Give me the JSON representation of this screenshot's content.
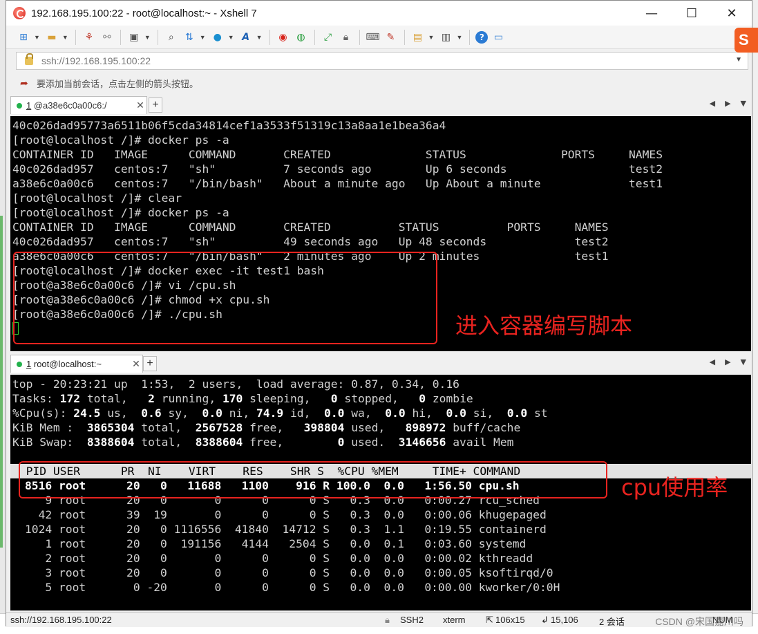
{
  "window": {
    "title": "192.168.195.100:22 - root@localhost:~ - Xshell 7",
    "controls": {
      "minimize": "—",
      "maximize": "☐",
      "close": "✕"
    }
  },
  "toolbar": {
    "icons": [
      "new-session-icon",
      "open-folder-icon",
      "disconnect-icon",
      "reconnect-icon",
      "properties-icon",
      "find-icon",
      "transfer-icon",
      "globe-icon",
      "font-icon",
      "xshell-icon",
      "xftp-icon",
      "fullscreen-icon",
      "lock-icon",
      "keyboard-icon",
      "highlight-icon",
      "script-icon",
      "layout-icon",
      "help-icon",
      "chat-icon"
    ]
  },
  "addressbar": {
    "value": "ssh://192.168.195.100:22"
  },
  "hintbar": {
    "text": "要添加当前会话，点击左侧的箭头按钮。"
  },
  "tabs_top": {
    "num": "1",
    "label": "@a38e6c0a00c6:/"
  },
  "tabs_bottom": {
    "num": "1",
    "label": "root@localhost:~"
  },
  "terminal_top": {
    "lines": [
      "40c026dad95773a6511b06f5cda34814cef1a3533f51319c13a8aa1e1bea36a4",
      "[root@localhost /]# docker ps -a",
      "CONTAINER ID   IMAGE      COMMAND       CREATED              STATUS              PORTS     NAMES",
      "40c026dad957   centos:7   \"sh\"          7 seconds ago        Up 6 seconds                  test2",
      "a38e6c0a00c6   centos:7   \"/bin/bash\"   About a minute ago   Up About a minute             test1",
      "[root@localhost /]# clear",
      "[root@localhost /]# docker ps -a",
      "CONTAINER ID   IMAGE      COMMAND       CREATED          STATUS          PORTS     NAMES",
      "40c026dad957   centos:7   \"sh\"          49 seconds ago   Up 48 seconds             test2",
      "a38e6c0a00c6   centos:7   \"/bin/bash\"   2 minutes ago    Up 2 minutes              test1",
      "[root@localhost /]# docker exec -it test1 bash",
      "[root@a38e6c0a00c6 /]# vi /cpu.sh",
      "[root@a38e6c0a00c6 /]# chmod +x cpu.sh",
      "[root@a38e6c0a00c6 /]# ./cpu.sh"
    ],
    "annotation": "进入容器编写脚本"
  },
  "terminal_bottom": {
    "top_line": "top - 20:23:21 up  1:53,  2 users,  load average: 0.87, 0.34, 0.16",
    "tasks": {
      "label": "Tasks:",
      "total": "172",
      "running": "2",
      "sleeping": "170",
      "stopped": "0",
      "zombie": "0"
    },
    "cpu": {
      "label": "%Cpu(s):",
      "us": "24.5",
      "sy": "0.6",
      "ni": "0.0",
      "id": "74.9",
      "wa": "0.0",
      "hi": "0.0",
      "si": "0.0",
      "st": "0.0"
    },
    "mem": {
      "label": "KiB Mem :",
      "total": "3865304",
      "free": "2567528",
      "used": "398804",
      "buff": "898972"
    },
    "swap": {
      "label": "KiB Swap:",
      "total": "8388604",
      "free": "8388604",
      "used": "0",
      "avail": "3146656"
    },
    "header": "  PID USER      PR  NI    VIRT    RES    SHR S  %CPU %MEM     TIME+ COMMAND",
    "rows": [
      "8516 root      20   0   11688   1100    916 R 100.0  0.0   1:56.50 cpu.sh",
      "   9 root      20   0       0      0      0 S   0.3  0.0   0:00.27 rcu_sched",
      "  42 root      39  19       0      0      0 S   0.3  0.0   0:00.06 khugepaged",
      "1024 root      20   0 1116556  41840  14712 S   0.3  1.1   0:19.55 containerd",
      "   1 root      20   0  191156   4144   2504 S   0.0  0.1   0:03.60 systemd",
      "   2 root      20   0       0      0      0 S   0.0  0.0   0:00.02 kthreadd",
      "   3 root      20   0       0      0      0 S   0.0  0.0   0:00.05 ksoftirqd/0",
      "   5 root       0 -20       0      0      0 S   0.0  0.0   0:00.00 kworker/0:0H"
    ],
    "annotation": "cpu使用率"
  },
  "statusbar": {
    "address": "ssh://192.168.195.100:22",
    "protocol": "SSH2",
    "term": "xterm",
    "size": "106x15",
    "cursor": "15,106",
    "sessions": "2 会话",
    "watermark": "CSDN @宋国嘉川吗",
    "num": "NUM"
  }
}
